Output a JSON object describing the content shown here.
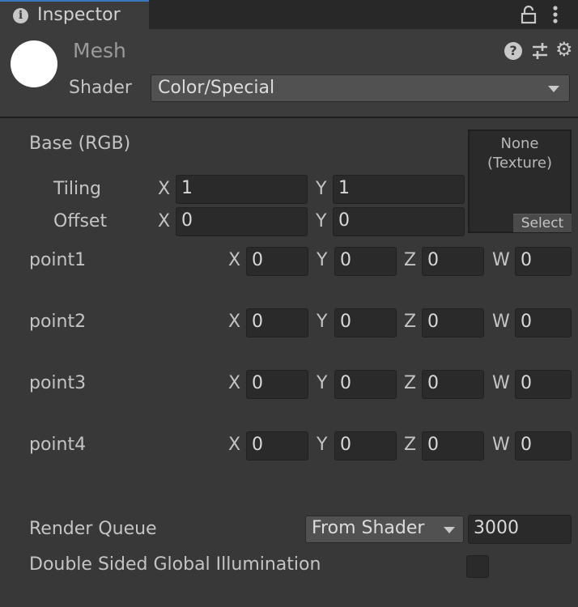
{
  "tab": {
    "label": "Inspector"
  },
  "header": {
    "title": "Mesh",
    "shader_label": "Shader",
    "shader_value": "Color/Special"
  },
  "base": {
    "label": "Base (RGB)",
    "tiling": {
      "label": "Tiling",
      "x_axis": "X",
      "x": "1",
      "y_axis": "Y",
      "y": "1"
    },
    "offset": {
      "label": "Offset",
      "x_axis": "X",
      "x": "0",
      "y_axis": "Y",
      "y": "0"
    },
    "texture": {
      "line1": "None",
      "line2": "(Texture)",
      "select": "Select"
    }
  },
  "points": [
    {
      "label": "point1",
      "x": "0",
      "y": "0",
      "z": "0",
      "w": "0"
    },
    {
      "label": "point2",
      "x": "0",
      "y": "0",
      "z": "0",
      "w": "0"
    },
    {
      "label": "point3",
      "x": "0",
      "y": "0",
      "z": "0",
      "w": "0"
    },
    {
      "label": "point4",
      "x": "0",
      "y": "0",
      "z": "0",
      "w": "0"
    }
  ],
  "axes": {
    "x": "X",
    "y": "Y",
    "z": "Z",
    "w": "W"
  },
  "render_queue": {
    "label": "Render Queue",
    "mode": "From Shader",
    "value": "3000"
  },
  "double_sided_gi": {
    "label": "Double Sided Global Illumination",
    "checked": false
  },
  "icons": {
    "info": "info-icon",
    "lock": "lock-icon",
    "menu": "kebab-menu-icon",
    "help": "help-icon",
    "presets": "sliders-icon",
    "settings": "gear-icon"
  }
}
